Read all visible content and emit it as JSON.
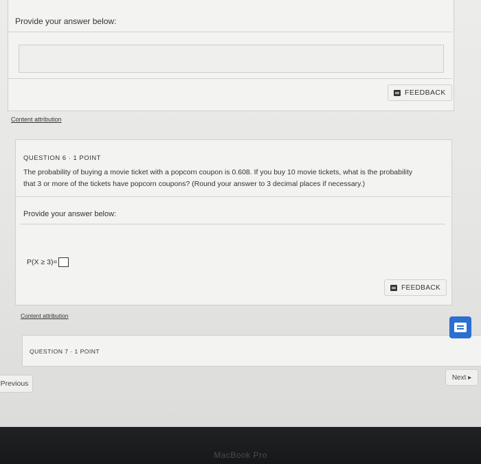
{
  "q5": {
    "provide_label": "Provide your answer below:",
    "feedback_label": "FEEDBACK",
    "content_attribution": "Content attribution"
  },
  "q6": {
    "header": "QUESTION 6 · 1 POINT",
    "question_line1": "The probability of buying a movie ticket with a popcorn coupon is 0.608. If you buy 10 movie tickets, what is the probability",
    "question_line2": "that 3  or more of the tickets have popcorn coupons? (Round your answer to 3 decimal places if necessary.)",
    "provide_label": "Provide your answer below:",
    "expression": "P(X ≥ 3)=",
    "answer_value": "",
    "feedback_label": "FEEDBACK",
    "content_attribution": "Content attribution"
  },
  "q7": {
    "header": "QUESTION 7 · 1 POINT"
  },
  "nav": {
    "previous": "Previous",
    "next": "Next ▸"
  },
  "device": {
    "brand": "MacBook Pro"
  },
  "colors": {
    "accent": "#2a6fd1"
  }
}
